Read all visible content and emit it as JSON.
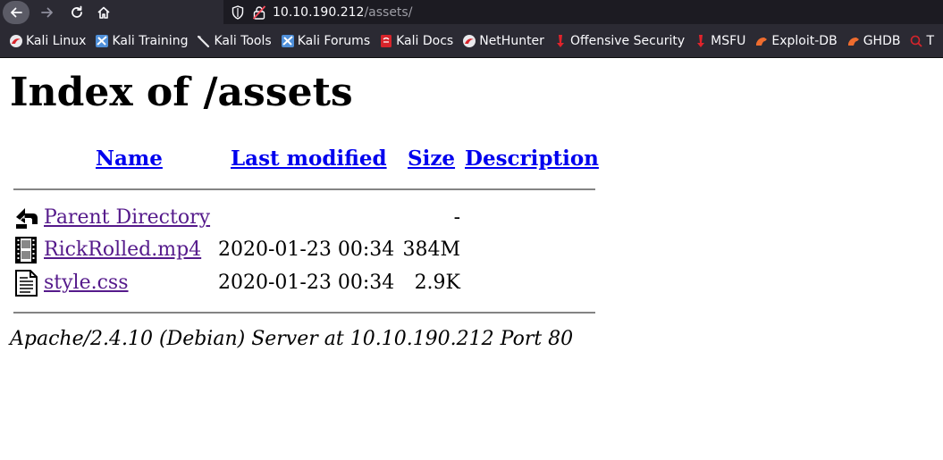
{
  "browser": {
    "url_host": "10.10.190.212",
    "url_path": "/assets/",
    "bookmarks": [
      {
        "label": "Kali Linux",
        "icon": "kali-dragon-icon"
      },
      {
        "label": "Kali Training",
        "icon": "kali-training-icon"
      },
      {
        "label": "Kali Tools",
        "icon": "kali-tools-icon"
      },
      {
        "label": "Kali Forums",
        "icon": "kali-forums-icon"
      },
      {
        "label": "Kali Docs",
        "icon": "kali-docs-icon"
      },
      {
        "label": "NetHunter",
        "icon": "nethunter-icon"
      },
      {
        "label": "Offensive Security",
        "icon": "offsec-icon"
      },
      {
        "label": "MSFU",
        "icon": "msfu-icon"
      },
      {
        "label": "Exploit-DB",
        "icon": "exploit-db-icon"
      },
      {
        "label": "GHDB",
        "icon": "ghdb-icon"
      },
      {
        "label": "T",
        "icon": "search-icon"
      }
    ]
  },
  "page": {
    "title": "Index of /assets",
    "columns": {
      "name": "Name",
      "last_modified": "Last modified",
      "size": "Size",
      "description": "Description"
    },
    "rows": [
      {
        "name": "Parent Directory",
        "modified": "",
        "size": "-",
        "description": "",
        "icon": "back-folder-icon"
      },
      {
        "name": "RickRolled.mp4",
        "modified": "2020-01-23 00:34",
        "size": "384M",
        "description": "",
        "icon": "movie-file-icon"
      },
      {
        "name": "style.css",
        "modified": "2020-01-23 00:34",
        "size": "2.9K",
        "description": "",
        "icon": "text-file-icon"
      }
    ],
    "footer": "Apache/2.4.10 (Debian) Server at 10.10.190.212 Port 80"
  }
}
